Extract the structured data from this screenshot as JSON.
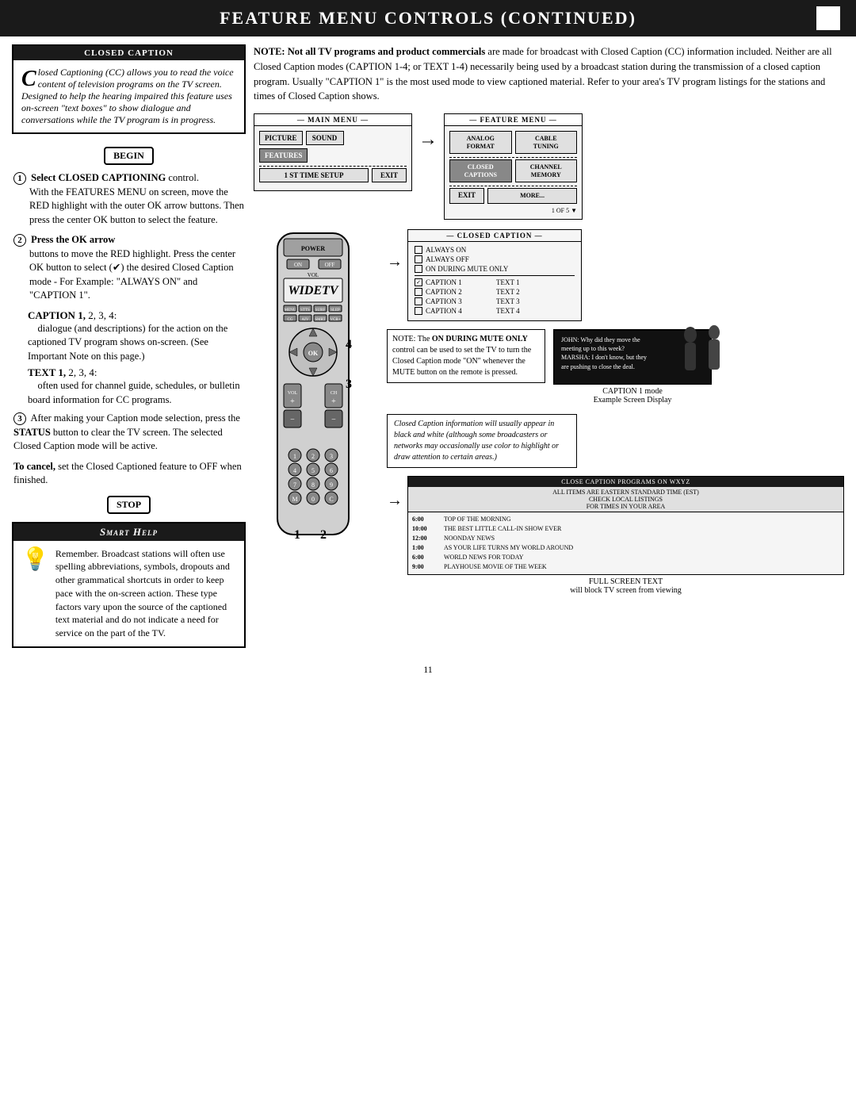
{
  "header": {
    "title": "Feature Menu Controls (Continued)",
    "box_label": ""
  },
  "closed_caption_section": {
    "title": "Closed Caption",
    "body_text": "losed Captioning (CC) allows you to read the voice content of television programs on the TV screen. Designed to help the hearing impaired this feature uses on-screen \"text boxes\" to show dialogue and conversations while the TV program is in progress.",
    "begin_label": "BEGIN",
    "stop_label": "STOP"
  },
  "note_text": "NOTE: Not all TV programs and product commercials are made for broadcast with Closed Caption (CC) information included. Neither are all Closed Caption modes (CAPTION 1-4; or TEXT 1-4) necessarily being used by a broadcast station during the transmission of a closed caption program. Usually \"CAPTION 1\" is the most used mode to view captioned material. Refer to your area's TV program listings for the stations and times of Closed Caption shows.",
  "steps": [
    {
      "number": "1",
      "header": "Select CLOSED CAPTIONING control.",
      "body": "With the FEATURES MENU on screen, move the RED highlight with the outer OK arrow buttons. Then press the center OK button to select the feature."
    },
    {
      "number": "2",
      "header": "Press the OK arrow",
      "body": "buttons to move the RED highlight. Press the center OK button to select (✔) the desired Closed Caption mode - For Example: \"ALWAYS ON\" and \"CAPTION 1\"."
    },
    {
      "number": "3",
      "header": "",
      "body": "After making your Caption mode selection, press the STATUS button to clear the TV screen. The selected Closed Caption mode will be active."
    }
  ],
  "caption_bold_items": [
    {
      "label": "CAPTION 1,",
      "rest": " 2, 3, 4:",
      "description": "dialogue (and descriptions) for the action on the captioned TV program shows on-screen. (See Important Note on this page.)"
    },
    {
      "label": "TEXT 1,",
      "rest": " 2, 3, 4:",
      "description": "often used for channel guide, schedules, or bulletin board information for CC programs."
    }
  ],
  "cancel_text": "To cancel, set the Closed Captioned feature to OFF when finished.",
  "smart_help": {
    "title": "Smart Help",
    "body": "Remember. Broadcast stations will often use spelling abbreviations, symbols, dropouts and other grammatical shortcuts in order to keep pace with the on-screen action. These type factors vary upon the source of the captioned text material and do not indicate a need for service on the part of the TV."
  },
  "main_menu": {
    "label": "MAIN MENU",
    "buttons": [
      "PICTURE",
      "SOUND",
      "FEATURES",
      "1 ST TIME SETUP",
      "EXIT"
    ]
  },
  "feature_menu": {
    "label": "FEATURE MENU",
    "buttons": [
      {
        "label": "ANALOG\nFORMAT"
      },
      {
        "label": "CABLE\nTUNING"
      },
      {
        "label": "CLOSED\nCAPTIONS",
        "highlight": true
      },
      {
        "label": "CHANNEL\nMEMORY"
      },
      {
        "label": "EXIT"
      },
      {
        "label": "MORE..."
      }
    ],
    "page_indicator": "1 OF 5"
  },
  "cc_menu": {
    "title": "CLOSED CAPTION",
    "options": [
      {
        "label": "ALWAYS ON",
        "checked": false
      },
      {
        "label": "ALWAYS OFF",
        "checked": false
      },
      {
        "label": "ON DURING MUTE ONLY",
        "checked": false
      }
    ],
    "caption_options": [
      {
        "label": "CAPTION 1",
        "checked": true
      },
      {
        "label": "CAPTION 2",
        "checked": false
      },
      {
        "label": "CAPTION 3",
        "checked": false
      },
      {
        "label": "CAPTION 4",
        "checked": false
      }
    ],
    "text_options": [
      {
        "label": "TEXT 1"
      },
      {
        "label": "TEXT 2"
      },
      {
        "label": "TEXT 3"
      },
      {
        "label": "TEXT 4"
      }
    ]
  },
  "mute_note": {
    "text": "NOTE: The ON DURING MUTE ONLY control can be used to set the TV to turn the Closed Caption mode \"ON\" whenever the MUTE button on the remote is pressed."
  },
  "caption_screen": {
    "title": "CAPTION 1 mode\nExample Screen Display",
    "dialogue": [
      "JOHN: Why did they move the meeting up to this week?",
      "MARSHA: I don't know, but they are pushing to close the deal."
    ]
  },
  "caption_note": {
    "text": "Closed Caption information will usually appear in black and white (although some broadcasters or networks may occasionally use color to highlight or draw attention to certain areas.)"
  },
  "full_screen": {
    "title": "CLOSE CAPTION PROGRAMS ON WXYZ",
    "subtitle": "ALL ITEMS ARE EASTERN STANDARD TIME (EST)\nCHECK LOCAL LISTINGS\nFOR TIMES IN YOUR AREA",
    "items": [
      {
        "time": "6:00",
        "show": "TOP OF THE MORNING"
      },
      {
        "time": "10:00",
        "show": "THE BEST LITTLE CALL-IN SHOW EVER"
      },
      {
        "time": "12:00",
        "show": "NOONDAY NEWS"
      },
      {
        "time": "1:00",
        "show": "AS YOUR LIFE TURNS MY WORLD AROUND"
      },
      {
        "time": "6:00",
        "show": "WORLD NEWS FOR TODAY"
      },
      {
        "time": "9:00",
        "show": "PLAYHOUSE MOVIE OF THE WEEK"
      }
    ],
    "footer_label": "FULL SCREEN TEXT\nwill block TV screen from viewing"
  },
  "page_number": "11"
}
